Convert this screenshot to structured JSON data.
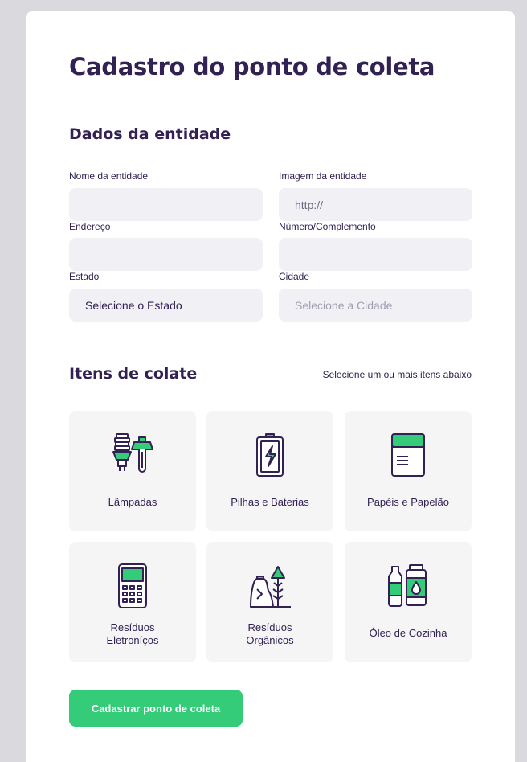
{
  "page_title": "Cadastro do ponto de coleta",
  "entity_section": {
    "title": "Dados da entidade",
    "fields": {
      "name": {
        "label": "Nome da entidade",
        "value": ""
      },
      "image": {
        "label": "Imagem da entidade",
        "placeholder": "http://"
      },
      "address": {
        "label": "Endereço",
        "value": ""
      },
      "number": {
        "label": "Número/Complemento",
        "value": ""
      },
      "state": {
        "label": "Estado",
        "selected": "Selecione o Estado"
      },
      "city": {
        "label": "Cidade",
        "selected": "Selecione a Cidade"
      }
    }
  },
  "items_section": {
    "title": "Itens de colate",
    "hint": "Selecione um ou mais itens abaixo",
    "items": [
      {
        "label": "Lâmpadas",
        "icon": "lamps-icon"
      },
      {
        "label": "Pilhas e Baterias",
        "icon": "battery-icon"
      },
      {
        "label": "Papéis e Papelão",
        "icon": "paper-icon"
      },
      {
        "label": "Resíduos\nEletroníços",
        "icon": "electronics-icon"
      },
      {
        "label": "Resíduos\nOrgânicos",
        "icon": "organic-icon"
      },
      {
        "label": "Óleo de Cozinha",
        "icon": "oil-icon"
      }
    ]
  },
  "submit_label": "Cadastrar ponto de coleta",
  "colors": {
    "accent": "#34cb79",
    "text": "#322153",
    "input_bg": "#f0f0f5",
    "item_bg": "#f5f5f5"
  }
}
